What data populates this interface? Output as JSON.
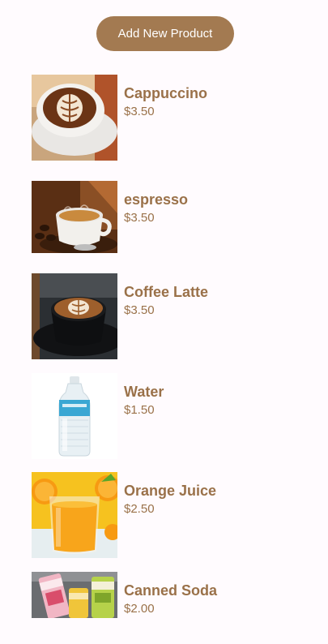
{
  "header": {
    "add_button_label": "Add New Product"
  },
  "products": [
    {
      "name": "Cappuccino",
      "price": "$3.50",
      "image_icon": "cappuccino-image"
    },
    {
      "name": "espresso",
      "price": "$3.50",
      "image_icon": "espresso-image"
    },
    {
      "name": "Coffee Latte",
      "price": "$3.50",
      "image_icon": "coffee-latte-image"
    },
    {
      "name": "Water",
      "price": "$1.50",
      "image_icon": "water-bottle-image"
    },
    {
      "name": "Orange Juice",
      "price": "$2.50",
      "image_icon": "orange-juice-image"
    },
    {
      "name": "Canned Soda",
      "price": "$2.00",
      "image_icon": "canned-soda-image"
    }
  ],
  "colors": {
    "accent": "#a37a51",
    "text": "#9a7149",
    "background": "#fffbfe"
  }
}
